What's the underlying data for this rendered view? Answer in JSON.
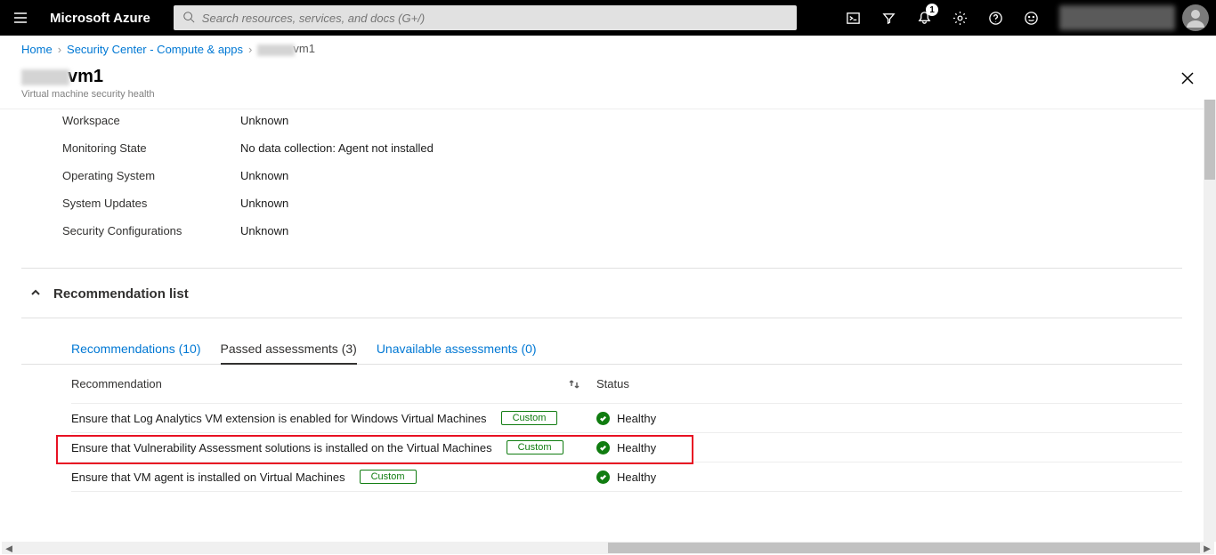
{
  "header": {
    "brand": "Microsoft Azure",
    "search_placeholder": "Search resources, services, and docs (G+/)",
    "notification_count": "1"
  },
  "breadcrumb": {
    "home": "Home",
    "sec": "Security Center - Compute & apps",
    "current_suffix": "vm1"
  },
  "blade": {
    "title_suffix": "vm1",
    "subtitle": "Virtual machine security health"
  },
  "properties": [
    {
      "label": "Workspace",
      "value": "Unknown"
    },
    {
      "label": "Monitoring State",
      "value": "No data collection: Agent not installed"
    },
    {
      "label": "Operating System",
      "value": "Unknown"
    },
    {
      "label": "System Updates",
      "value": "Unknown"
    },
    {
      "label": "Security Configurations",
      "value": "Unknown"
    }
  ],
  "section": {
    "title": "Recommendation list"
  },
  "tabs": {
    "recommendations": "Recommendations (10)",
    "passed": "Passed assessments (3)",
    "unavailable": "Unavailable assessments (0)"
  },
  "columns": {
    "rec": "Recommendation",
    "status": "Status"
  },
  "badges": {
    "custom": "Custom"
  },
  "statuses": {
    "healthy": "Healthy"
  },
  "rows": [
    {
      "text": "Ensure that Log Analytics VM extension is enabled for Windows Virtual Machines",
      "status": "Healthy"
    },
    {
      "text": "Ensure that Vulnerability Assessment solutions is installed on the Virtual Machines",
      "status": "Healthy"
    },
    {
      "text": "Ensure that VM agent is installed on Virtual Machines",
      "status": "Healthy"
    }
  ]
}
